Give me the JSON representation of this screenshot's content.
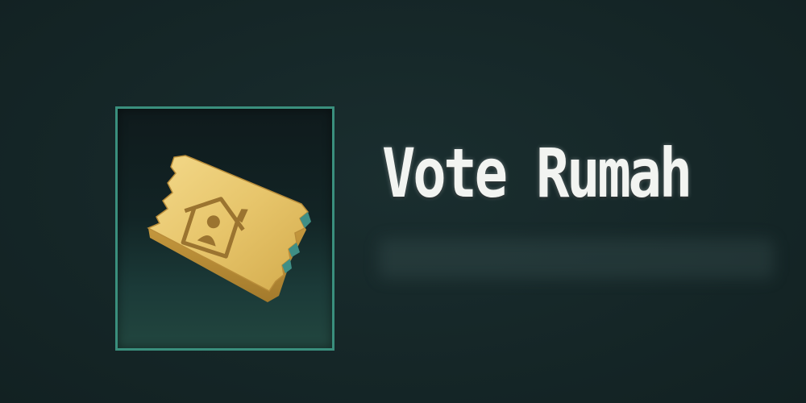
{
  "item": {
    "title": "Vote Rumah",
    "icon": "golden-ticket-house-icon"
  },
  "colors": {
    "background": "#16282a",
    "frame_border": "#3a8f7d",
    "title_text": "#f2f4f1",
    "ticket_gold": "#e6c46a"
  }
}
